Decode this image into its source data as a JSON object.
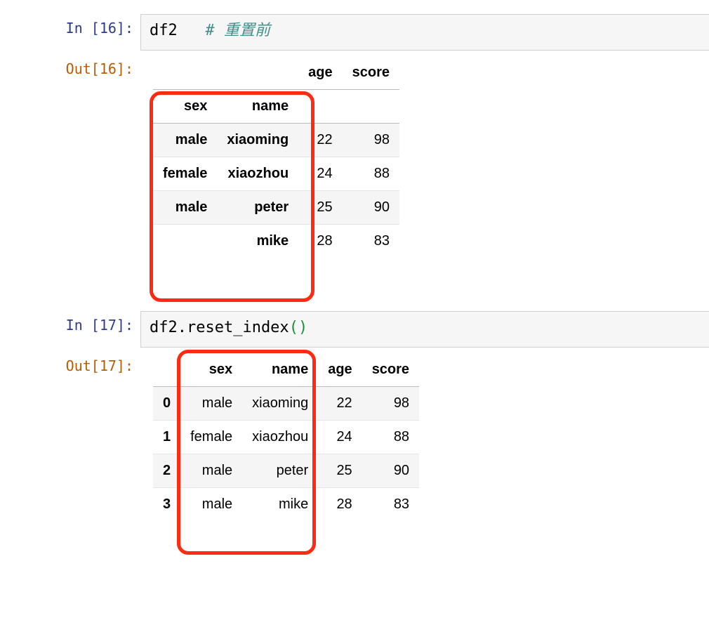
{
  "cells": {
    "cell16": {
      "in_label": "In [16]:",
      "out_label": "Out[16]:",
      "code": {
        "expr": "df2",
        "comment": "# 重置前"
      },
      "table": {
        "columns": [
          "age",
          "score"
        ],
        "index_names": [
          "sex",
          "name"
        ],
        "rows": [
          {
            "index": [
              "male",
              "xiaoming"
            ],
            "values": [
              "22",
              "98"
            ]
          },
          {
            "index": [
              "female",
              "xiaozhou"
            ],
            "values": [
              "24",
              "88"
            ]
          },
          {
            "index": [
              "male",
              "peter"
            ],
            "values": [
              "25",
              "90"
            ]
          },
          {
            "index": [
              "",
              "mike"
            ],
            "values": [
              "28",
              "83"
            ]
          }
        ]
      }
    },
    "cell17": {
      "in_label": "In [17]:",
      "out_label": "Out[17]:",
      "code": {
        "expr": "df2.reset_index",
        "paren_open": "(",
        "paren_close": ")"
      },
      "table": {
        "columns": [
          "sex",
          "name",
          "age",
          "score"
        ],
        "rows": [
          {
            "index": "0",
            "sex": "male",
            "name": "xiaoming",
            "age": "22",
            "score": "98"
          },
          {
            "index": "1",
            "sex": "female",
            "name": "xiaozhou",
            "age": "24",
            "score": "88"
          },
          {
            "index": "2",
            "sex": "male",
            "name": "peter",
            "age": "25",
            "score": "90"
          },
          {
            "index": "3",
            "sex": "male",
            "name": "mike",
            "age": "28",
            "score": "83"
          }
        ]
      }
    }
  }
}
